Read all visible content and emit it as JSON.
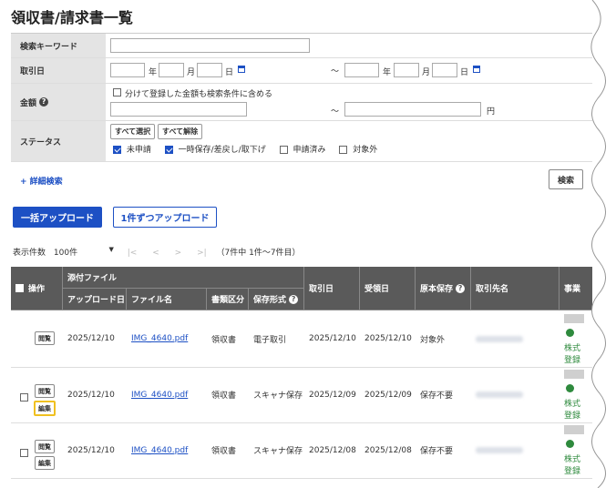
{
  "page": {
    "title": "領収書/請求書一覧"
  },
  "search": {
    "keyword_label": "検索キーワード",
    "keyword_value": "",
    "date_label": "取引日",
    "year_unit": "年",
    "month_unit": "月",
    "day_unit": "日",
    "range_sep": "～",
    "amount_label": "金額",
    "split_checkbox_label": "分けて登録した金額も検索条件に含める",
    "yen_unit": "円",
    "status_label": "ステータス",
    "select_all": "すべて選択",
    "deselect_all": "すべて解除",
    "status_options": [
      {
        "label": "未申請",
        "checked": true
      },
      {
        "label": "一時保存/差戻し/取下げ",
        "checked": true
      },
      {
        "label": "申請済み",
        "checked": false
      },
      {
        "label": "対象外",
        "checked": false
      }
    ],
    "advanced_link": "+ 詳細検索",
    "search_button": "検索"
  },
  "actions": {
    "bulk_upload": "一括アップロード",
    "single_upload": "1件ずつアップロード"
  },
  "pager": {
    "per_page_label": "表示件数",
    "per_page_value": "100件",
    "first": "|<",
    "prev": "<",
    "next": ">",
    "last": ">|",
    "summary": "（7件中 1件～7件目）"
  },
  "table": {
    "headers": {
      "action": "操作",
      "attachment_group": "添付ファイル",
      "upload_date": "アップロード日",
      "file_name": "ファイル名",
      "doc_type": "書類区分",
      "storage_format": "保存形式",
      "transaction_date": "取引日",
      "receipt_date": "受領日",
      "original_storage": "原本保存",
      "partner": "取引先名",
      "business": "事業"
    },
    "view_button": "閲覧",
    "edit_button": "編集",
    "rows": [
      {
        "upload_date": "2025/12/10",
        "file_name": "IMG_4640.pdf",
        "doc_type": "領収書",
        "storage_format": "電子取引",
        "transaction_date": "2025/12/10",
        "receipt_date": "2025/12/10",
        "original_storage": "対象外",
        "business_line1": "株式",
        "business_line2": "登録",
        "has_checkbox": false,
        "has_edit": false
      },
      {
        "upload_date": "2025/12/10",
        "file_name": "IMG_4640.pdf",
        "doc_type": "領収書",
        "storage_format": "スキャナ保存",
        "transaction_date": "2025/12/09",
        "receipt_date": "2025/12/09",
        "original_storage": "保存不要",
        "business_line1": "株式",
        "business_line2": "登録",
        "has_checkbox": true,
        "has_edit": true
      },
      {
        "upload_date": "2025/12/10",
        "file_name": "IMG_4640.pdf",
        "doc_type": "領収書",
        "storage_format": "スキャナ保存",
        "transaction_date": "2025/12/08",
        "receipt_date": "2025/12/08",
        "original_storage": "保存不要",
        "business_line1": "株式",
        "business_line2": "登録",
        "has_checkbox": true,
        "has_edit": true
      }
    ]
  }
}
